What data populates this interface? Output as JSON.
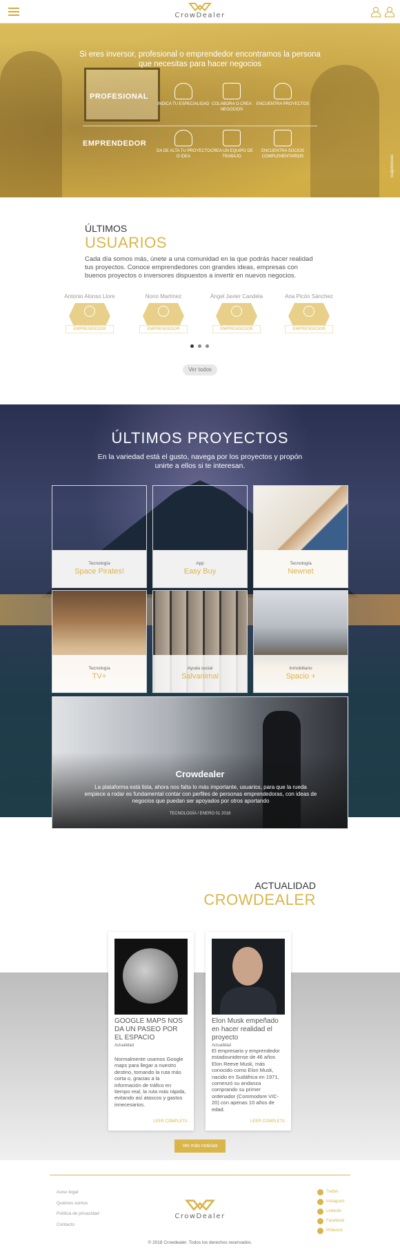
{
  "header": {
    "logo_text": "CrowDealer",
    "accent": "#d9b54a"
  },
  "hero": {
    "intro": "Si eres inversor, profesional o emprendedor encontramos la persona que necesitas para hacer negocios",
    "row1": {
      "label": "PROFESIONAL",
      "items": [
        "INDICA TU ESPECIALIDAD",
        "COLABORA O CREA NEGOCIOS",
        "ENCUENTRA PROYECTOS"
      ]
    },
    "row2": {
      "label": "EMPRENDEDOR",
      "items": [
        "DA DE ALTA TU PROYECTO O IDEA",
        "CREA UN EQUIPO DE TRABAJO",
        "ENCUENTRA SOCIOS COMPLEMENTARIOS"
      ]
    },
    "side_tab": "Sugerencias"
  },
  "users": {
    "title_1": "ÚLTIMOS",
    "title_2": "USUARIOS",
    "description": "Cada día somos más, únete a una comunidad en la que podrás hacer realidad tus proyectos. Conoce emprendedores con grandes ideas, empresas con buenos proyectos o inversores dispuestos a invertir en nuevos negocios.",
    "cards": [
      {
        "name": "Antonio Alonso Llore",
        "role": "EMPRENDEDOR"
      },
      {
        "name": "Nono Martínez",
        "role": "EMPRENDEDOR"
      },
      {
        "name": "Ángel Javier Candela",
        "role": "EMPRENDEDOR"
      },
      {
        "name": "Ana Picón Sánchez",
        "role": "EMPRENDEDOR"
      }
    ],
    "see_all": "Ver todos"
  },
  "projects": {
    "title": "ÚLTIMOS PROYECTOS",
    "subtitle": "En la variedad está el gusto, navega por los proyectos y propón unirte a ellos si te interesan.",
    "cards": [
      {
        "category": "Tecnología",
        "name": "Space Pirates!"
      },
      {
        "category": "App",
        "name": "Easy Buy"
      },
      {
        "category": "Tecnología",
        "name": "Newnet"
      },
      {
        "category": "Tecnología",
        "name": "TV+"
      },
      {
        "category": "Ayuda social",
        "name": "Salvanimal"
      },
      {
        "category": "Inmobiliario",
        "name": "Spacio +"
      }
    ],
    "featured": {
      "title": "Crowdealer",
      "description": "La plataforma está lista, ahora nos falta lo más importante, usuarios, para que la rueda empiece a rodar es fundamental contar con perfiles de personas emprendedoras, con ideas de negocios que puedan ser apoyados por otros aportando",
      "meta": "TECNOLOGÍA / ENERO 01 2018"
    }
  },
  "news": {
    "title_1": "ACTUALIDAD",
    "title_2": "CROWDEALER",
    "cards": [
      {
        "title": "GOOGLE MAPS NOS DA UN PASEO POR EL ESPACIO",
        "category": "Actualidad",
        "text": "Normalmente usamos Google maps para llegar a nuestro destino, tomando la ruta más corta o, gracias a la información de tráfico en tiempo real, la ruta más rápida, evitando así atascos y gastos innecesarios.",
        "more": "LEER COMPLETA"
      },
      {
        "title": "Elon Musk empeñado en hacer realidad el proyecto",
        "category": "Actualidad",
        "text": "El empresario y emprendedor estadounidense de 46 años Elon Reeve Musk, más conocido como Elon Musk, nacido en Sudáfrica en 1971, comenzó su andanza comprando su primer ordenador (Commodore VIC-20) con apenas 10 años de edad.",
        "more": "LEER COMPLETA"
      }
    ],
    "more_button": "Ver más noticias"
  },
  "footer": {
    "links": [
      "Aviso legal",
      "Quiénes somos",
      "Política de privacidad",
      "Contacto"
    ],
    "logo_text": "CrowDealer",
    "social": [
      "Twitter",
      "Instagram",
      "Linkedin",
      "Facebook",
      "Pinterest"
    ],
    "copyright": "© 2018 Crowdealer. Todos los derechos reservados."
  }
}
